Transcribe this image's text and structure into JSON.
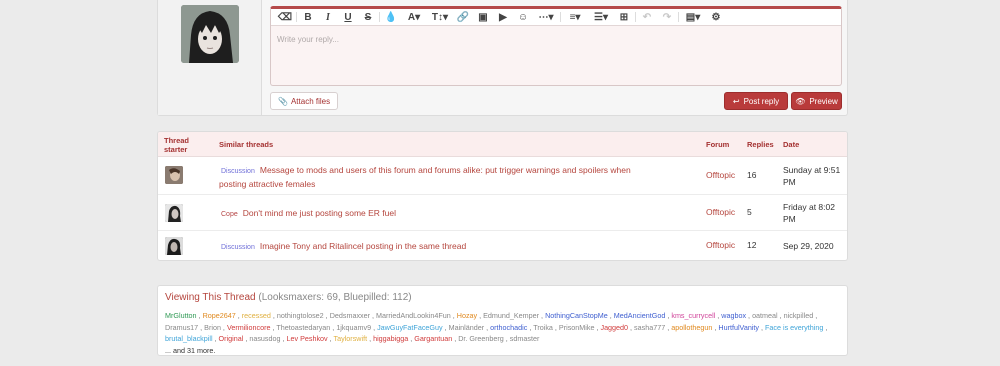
{
  "reply": {
    "placeholder": "Write your reply...",
    "attach_label": "Attach files",
    "post_label": "Post reply",
    "preview_label": "Preview"
  },
  "similar": {
    "headers": {
      "starter": "Thread starter",
      "title": "Similar threads",
      "forum": "Forum",
      "replies": "Replies",
      "date": "Date"
    },
    "rows": [
      {
        "prefix": "Discussion",
        "title": "Message to mods and users of this forum and forums alike: put trigger warnings and spoilers when posting attractive females",
        "forum": "Offtopic",
        "replies": "16",
        "date": "Sunday at 9:51 PM"
      },
      {
        "prefix": "Cope",
        "title": "Don't mind me just posting some ER fuel",
        "forum": "Offtopic",
        "replies": "5",
        "date": "Friday at 8:02 PM"
      },
      {
        "prefix": "Discussion",
        "title": "Imagine Tony and Ritalincel posting in the same thread",
        "forum": "Offtopic",
        "replies": "12",
        "date": "Sep 29, 2020"
      }
    ]
  },
  "viewing": {
    "title": "Viewing This Thread",
    "subtitle": "(Looksmaxers: 69, Bluepilled: 112)",
    "more": "... and 31 more.",
    "users": [
      {
        "name": "MrGlutton",
        "color": "#2f9a55"
      },
      {
        "name": "Rope2647",
        "color": "#e08a20"
      },
      {
        "name": "recessed",
        "color": "#e0b040"
      },
      {
        "name": "nothingtolose2",
        "color": "#888888"
      },
      {
        "name": "Dedsmaxxer",
        "color": "#888888"
      },
      {
        "name": "MarriedAndLookin4Fun",
        "color": "#888888"
      },
      {
        "name": "Hozay",
        "color": "#e08a20"
      },
      {
        "name": "Edmund_Kemper",
        "color": "#888888"
      },
      {
        "name": "NothingCanStopMe",
        "color": "#3f5fd0"
      },
      {
        "name": "MedAncientGod",
        "color": "#3f5fd0"
      },
      {
        "name": "kms_currycell",
        "color": "#d0449a"
      },
      {
        "name": "wagbox",
        "color": "#3f5fd0"
      },
      {
        "name": "oatmeal",
        "color": "#888888"
      },
      {
        "name": "nickpilled",
        "color": "#888888"
      },
      {
        "name": "Dramus17",
        "color": "#888888"
      },
      {
        "name": "Brion",
        "color": "#888888"
      },
      {
        "name": "Vermilioncore",
        "color": "#d03c3c"
      },
      {
        "name": "Thetoastedaryan",
        "color": "#888888"
      },
      {
        "name": "1jkquamv9",
        "color": "#888888"
      },
      {
        "name": "JawGuyFatFaceGuy",
        "color": "#3fa4d8"
      },
      {
        "name": "Mainländer",
        "color": "#888888"
      },
      {
        "name": "orthochadic",
        "color": "#3f5fd0"
      },
      {
        "name": "Troika",
        "color": "#888888"
      },
      {
        "name": "PrisonMike",
        "color": "#888888"
      },
      {
        "name": "Jagged0",
        "color": "#d03c3c"
      },
      {
        "name": "sasha777",
        "color": "#888888"
      },
      {
        "name": "apollothegun",
        "color": "#e08a20"
      },
      {
        "name": "HurtfulVanity",
        "color": "#3f5fd0"
      },
      {
        "name": "Face is everything",
        "color": "#3fa4d8"
      },
      {
        "name": "brutal_blackpill",
        "color": "#3fa4d8"
      },
      {
        "name": "Original",
        "color": "#d03c3c"
      },
      {
        "name": "nasusdog",
        "color": "#888888"
      },
      {
        "name": "Lev Peshkov",
        "color": "#d03c3c"
      },
      {
        "name": "Taylorswift",
        "color": "#e0b040"
      },
      {
        "name": "higgabigga",
        "color": "#d03c3c"
      },
      {
        "name": "Gargantuan",
        "color": "#d03c3c"
      },
      {
        "name": "Dr. Greenberg",
        "color": "#888888"
      },
      {
        "name": "sdmaster",
        "color": "#888888"
      }
    ]
  }
}
